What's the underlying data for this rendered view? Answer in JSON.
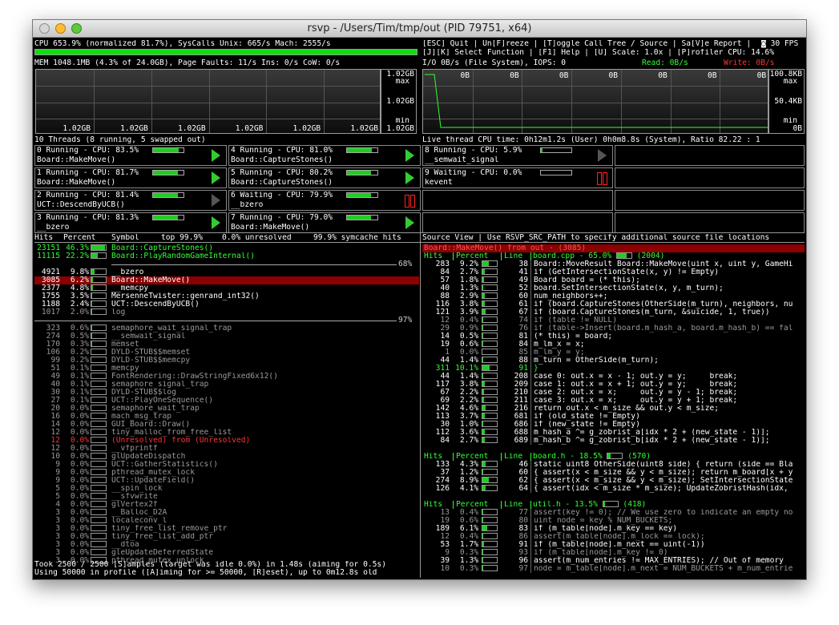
{
  "window": {
    "title": "rsvp - /Users/Tim/tmp/out (PID 79751, x64)"
  },
  "cpu": {
    "text": "CPU 653.9% (normalized 81.7%), SysCalls Unix: 665/s Mach: 2555/s",
    "bar_fraction": 1.0
  },
  "help": {
    "line1": "[ESC] Quit | Un[F]reeze | [T]oggle Call Tree / Source | Sa[V]e Report |",
    "line2": "[J][K] Select Function | [F1] Help | [U] Scale: 1.0x | [P]rofiler CPU: 14.6%",
    "fps": "30 FPS",
    "fps_icon": "camera-icon"
  },
  "mem": {
    "text": "MEM 1048.1MB (4.3% of 24.0GB), Page Faults: 11/s Ins: 0/s CoW: 0/s",
    "graph_labels": [
      "1.02GB",
      "1.02GB",
      "1.02GB",
      "1.02GB",
      "1.02GB",
      "1.02GB"
    ],
    "max_value": "1.02GB",
    "max_label": "max",
    "mid_value": "1.02GB",
    "min_value": "1.02GB",
    "min_label": "min"
  },
  "io": {
    "text": "I/O 0B/s (File System), IOPS: 0",
    "read_label": "Read: 0B/s",
    "write_label": "Write: 0B/s",
    "graph_labels": [
      "0B",
      "0B",
      "0B",
      "0B",
      "0B",
      "0B",
      "0B"
    ],
    "max_value": "100.8KB",
    "max_label": "max",
    "mid_value": "50.4KB",
    "min_label": "min",
    "min_value": "0B"
  },
  "threads": {
    "header": "10 Threads (8 running, 5 swapped out)",
    "live": "Live thread CPU time: 0h12m1.2s (User) 0h0m8.8s (System), Ratio 82.22 : 1",
    "items": [
      {
        "line1": "0 Running - CPU: 83.5%",
        "fn": "Board::MakeMove()",
        "cpu": 0.835,
        "state": "running"
      },
      {
        "line1": "1 Running - CPU: 81.7%",
        "fn": "Board::MakeMove()",
        "cpu": 0.817,
        "state": "running"
      },
      {
        "line1": "2 Running - CPU: 81.4%",
        "fn": "UCT::DescendByUCB()",
        "cpu": 0.814,
        "state": "idle"
      },
      {
        "line1": "3 Running - CPU: 81.3%",
        "fn": "__bzero",
        "cpu": 0.813,
        "state": "running"
      },
      {
        "line1": "4 Running - CPU: 81.0%",
        "fn": "Board::CaptureStones()",
        "cpu": 0.81,
        "state": "running"
      },
      {
        "line1": "5 Running - CPU: 80.2%",
        "fn": "Board::CaptureStones()",
        "cpu": 0.802,
        "state": "running"
      },
      {
        "line1": "6 Waiting - CPU: 79.9%",
        "fn": "__bzero",
        "cpu": 0.799,
        "state": "paused"
      },
      {
        "line1": "7 Running - CPU: 79.0%",
        "fn": "Board::MakeMove()",
        "cpu": 0.79,
        "state": "running"
      },
      {
        "line1": "8 Running - CPU: 5.9%",
        "fn": "__semwait_signal",
        "cpu": 0.059,
        "state": "idle"
      },
      {
        "line1": "9 Waiting - CPU: 0.0%",
        "fn": "kevent",
        "cpu": 0.0,
        "state": "paused"
      }
    ]
  },
  "profile": {
    "header": {
      "hits": "Hits",
      "percent": "Percent",
      "symbol": "Symbol",
      "top": "top 99.9%",
      "unresolved": "0.0% unresolved",
      "symcache": "99.9% symcache hits"
    },
    "marker1": "68%",
    "marker2": "97%",
    "group1": [
      {
        "hits": "23151",
        "pct": "46.3%",
        "frac": 0.463,
        "sym": "Board::CaptureStones()"
      },
      {
        "hits": "11115",
        "pct": "22.2%",
        "frac": 0.222,
        "sym": "Board::PlayRandomGameInternal()"
      }
    ],
    "group2": [
      {
        "hits": "4921",
        "pct": "9.8%",
        "frac": 0.098,
        "sym": "__bzero"
      },
      {
        "hits": "3085",
        "pct": "6.2%",
        "frac": 0.062,
        "sym": "Board::MakeMove()"
      },
      {
        "hits": "2377",
        "pct": "4.8%",
        "frac": 0.048,
        "sym": "__memcpy"
      },
      {
        "hits": "1755",
        "pct": "3.5%",
        "frac": 0.035,
        "sym": "MersenneTwister::genrand_int32()"
      },
      {
        "hits": "1188",
        "pct": "2.4%",
        "frac": 0.024,
        "sym": "UCT::DescendByUCB()"
      },
      {
        "hits": "1017",
        "pct": "2.0%",
        "frac": 0.02,
        "sym": "log"
      }
    ],
    "group3": [
      {
        "hits": "323",
        "pct": "0.6%",
        "frac": 0.006,
        "sym": "semaphore_wait_signal_trap"
      },
      {
        "hits": "274",
        "pct": "0.5%",
        "frac": 0.005,
        "sym": "__semwait_signal"
      },
      {
        "hits": "170",
        "pct": "0.3%",
        "frac": 0.003,
        "sym": "memset"
      },
      {
        "hits": "106",
        "pct": "0.2%",
        "frac": 0.002,
        "sym": "DYLD-STUB$$memset"
      },
      {
        "hits": "99",
        "pct": "0.2%",
        "frac": 0.002,
        "sym": "DYLD-STUB$$memcpy"
      },
      {
        "hits": "51",
        "pct": "0.1%",
        "frac": 0.001,
        "sym": "memcpy"
      },
      {
        "hits": "49",
        "pct": "0.1%",
        "frac": 0.001,
        "sym": "FontRendering::DrawStringFixed6x12()"
      },
      {
        "hits": "40",
        "pct": "0.1%",
        "frac": 0.001,
        "sym": "semaphore_signal_trap"
      },
      {
        "hits": "30",
        "pct": "0.1%",
        "frac": 0.001,
        "sym": "DYLD-STUB$$log"
      },
      {
        "hits": "27",
        "pct": "0.1%",
        "frac": 0.001,
        "sym": "UCT::PlayOneSequence()"
      },
      {
        "hits": "20",
        "pct": "0.0%",
        "frac": 0.0,
        "sym": "semaphore_wait_trap"
      },
      {
        "hits": "16",
        "pct": "0.0%",
        "frac": 0.0,
        "sym": "mach_msg_trap"
      },
      {
        "hits": "14",
        "pct": "0.0%",
        "frac": 0.0,
        "sym": "GUI_Board::Draw()"
      },
      {
        "hits": "12",
        "pct": "0.0%",
        "frac": 0.0,
        "sym": "tiny_malloc_from_free_list"
      },
      {
        "hits": "12",
        "pct": "0.0%",
        "frac": 0.0,
        "sym": "(Unresolved) from (Unresolved)",
        "red": true
      },
      {
        "hits": "12",
        "pct": "0.0%",
        "frac": 0.0,
        "sym": "__vfprintf"
      },
      {
        "hits": "10",
        "pct": "0.0%",
        "frac": 0.0,
        "sym": "glUpdateDispatch"
      },
      {
        "hits": "9",
        "pct": "0.0%",
        "frac": 0.0,
        "sym": "UCT::GatherStatistics()"
      },
      {
        "hits": "9",
        "pct": "0.0%",
        "frac": 0.0,
        "sym": "pthread_mutex_lock"
      },
      {
        "hits": "9",
        "pct": "0.0%",
        "frac": 0.0,
        "sym": "UCT::UpdateField()"
      },
      {
        "hits": "5",
        "pct": "0.0%",
        "frac": 0.0,
        "sym": "__spin_lock"
      },
      {
        "hits": "5",
        "pct": "0.0%",
        "frac": 0.0,
        "sym": "__sfvwrite"
      },
      {
        "hits": "4",
        "pct": "0.0%",
        "frac": 0.0,
        "sym": "glVertex2f"
      },
      {
        "hits": "3",
        "pct": "0.0%",
        "frac": 0.0,
        "sym": "__Balloc_D2A"
      },
      {
        "hits": "3",
        "pct": "0.0%",
        "frac": 0.0,
        "sym": "localeconv_l"
      },
      {
        "hits": "3",
        "pct": "0.0%",
        "frac": 0.0,
        "sym": "tiny_free_list_remove_ptr"
      },
      {
        "hits": "3",
        "pct": "0.0%",
        "frac": 0.0,
        "sym": "tiny_free_list_add_ptr"
      },
      {
        "hits": "3",
        "pct": "0.0%",
        "frac": 0.0,
        "sym": "__dtoa"
      },
      {
        "hits": "3",
        "pct": "0.0%",
        "frac": 0.0,
        "sym": "gleUpdateDeferredState"
      },
      {
        "hits": "3",
        "pct": "0.0%",
        "frac": 0.0,
        "sym": "pthread_mutex_unlock"
      },
      {
        "hits": "3",
        "pct": "0.0%",
        "frac": 0.0,
        "sym": "glRotateXYZ_Exec"
      },
      {
        "hits": "3",
        "pct": "0.0%",
        "frac": 0.0,
        "sym": "UCT::DoWork()"
      }
    ],
    "footer1": "Took 2500 / 2500 [S]amples (target was idle 0.0%) in 1.48s (aiming for 0.5s)",
    "footer2": "Using 50000 in profile ([A]iming for >= 50000, [R]eset), up to 0m12.8s old"
  },
  "source": {
    "header": "Source View | Use RSVP_SRC_PATH to specify additional source file locations",
    "selected": "Board::MakeMove() from out - (3085)",
    "col_hits": "Hits",
    "col_percent": "Percent",
    "col_line": "Line",
    "files": [
      {
        "name": "board.cpp - 65.0%",
        "frac": 0.65,
        "count": "(2004)",
        "lines": [
          {
            "hits": "283",
            "pct": "9.2%",
            "frac": 0.092,
            "line": "38",
            "code": "Board::MoveResult Board::MakeMove(uint x, uint y, GameHi"
          },
          {
            "hits": "84",
            "pct": "2.7%",
            "frac": 0.027,
            "line": "41",
            "code": "if (GetIntersectionState(x, y) != Empty)"
          },
          {
            "hits": "57",
            "pct": "1.8%",
            "frac": 0.018,
            "line": "49",
            "code": "Board board = (* this);"
          },
          {
            "hits": "40",
            "pct": "1.3%",
            "frac": 0.013,
            "line": "52",
            "code": "board.SetIntersectionState(x, y, m_turn);"
          },
          {
            "hits": "88",
            "pct": "2.9%",
            "frac": 0.029,
            "line": "60",
            "code": "num_neighbors++;"
          },
          {
            "hits": "116",
            "pct": "3.8%",
            "frac": 0.038,
            "line": "61",
            "code": "if (board.CaptureStones(OtherSide(m_turn), neighbors, nu"
          },
          {
            "hits": "121",
            "pct": "3.9%",
            "frac": 0.039,
            "line": "67",
            "code": "if (board.CaptureStones(m_turn, &suicide, 1, true))"
          },
          {
            "hits": "12",
            "pct": "0.4%",
            "frac": 0.004,
            "line": "74",
            "code": "if (table != NULL)",
            "dim": true
          },
          {
            "hits": "29",
            "pct": "0.9%",
            "frac": 0.009,
            "line": "76",
            "code": "if (table->Insert(board.m_hash_a, board.m_hash_b) == fal",
            "dim": true
          },
          {
            "hits": "14",
            "pct": "0.5%",
            "frac": 0.005,
            "line": "81",
            "code": "(* this) = board;"
          },
          {
            "hits": "19",
            "pct": "0.6%",
            "frac": 0.006,
            "line": "84",
            "code": "m_lm_x = x;"
          },
          {
            "hits": "1",
            "pct": "0.0%",
            "frac": 0.0,
            "line": "85",
            "code": "m_lm_y = y;",
            "dim": true
          },
          {
            "hits": "44",
            "pct": "1.4%",
            "frac": 0.014,
            "line": "88",
            "code": "m_turn = OtherSide(m_turn);"
          },
          {
            "hits": "311",
            "pct": "10.1%",
            "frac": 0.101,
            "line": "91",
            "code": "}",
            "green": true
          },
          {
            "hits": "44",
            "pct": "1.4%",
            "frac": 0.014,
            "line": "208",
            "code": "case 0: out.x = x - 1; out.y = y;     break;"
          },
          {
            "hits": "117",
            "pct": "3.8%",
            "frac": 0.038,
            "line": "209",
            "code": "case 1: out.x = x + 1; out.y = y;     break;"
          },
          {
            "hits": "67",
            "pct": "2.2%",
            "frac": 0.022,
            "line": "210",
            "code": "case 2: out.x = x;     out.y = y - 1; break;"
          },
          {
            "hits": "69",
            "pct": "2.2%",
            "frac": 0.022,
            "line": "211",
            "code": "case 3: out.x = x;     out.y = y + 1; break;"
          },
          {
            "hits": "142",
            "pct": "4.6%",
            "frac": 0.046,
            "line": "216",
            "code": "return out.x < m_size && out.y < m_size;"
          },
          {
            "hits": "113",
            "pct": "3.7%",
            "frac": 0.037,
            "line": "681",
            "code": "if (old_state != Empty)"
          },
          {
            "hits": "30",
            "pct": "1.0%",
            "frac": 0.01,
            "line": "686",
            "code": "if (new_state != Empty)"
          },
          {
            "hits": "112",
            "pct": "3.6%",
            "frac": 0.036,
            "line": "688",
            "code": "m_hash_a ^= g_zobrist_a[idx * 2 + (new_state - 1)];"
          },
          {
            "hits": "84",
            "pct": "2.7%",
            "frac": 0.027,
            "line": "689",
            "code": "m_hash_b ^= g_zobrist_b[idx * 2 + (new_state - 1)];"
          }
        ]
      },
      {
        "name": "board.h - 18.5%",
        "frac": 0.185,
        "count": "(570)",
        "lines": [
          {
            "hits": "133",
            "pct": "4.3%",
            "frac": 0.043,
            "line": "46",
            "code": "static uint8 OtherSide(uint8 side) { return (side == Bla"
          },
          {
            "hits": "37",
            "pct": "1.2%",
            "frac": 0.012,
            "line": "60",
            "code": "{ assert(x < m_size && y < m_size); return m_board[x + y"
          },
          {
            "hits": "274",
            "pct": "8.9%",
            "frac": 0.089,
            "line": "62",
            "code": "{ assert(x < m_size && y < m_size); SetIntersectionState"
          },
          {
            "hits": "126",
            "pct": "4.1%",
            "frac": 0.041,
            "line": "64",
            "code": "{ assert(idx < m_size * m_size); UpdateZobristHash(idx,"
          }
        ]
      },
      {
        "name": "util.h - 13.5%",
        "frac": 0.135,
        "count": "(418)",
        "lines": [
          {
            "hits": "13",
            "pct": "0.4%",
            "frac": 0.004,
            "line": "77",
            "code": "assert(key != 0); // We use zero to indicate an empty no",
            "dim": true
          },
          {
            "hits": "19",
            "pct": "0.6%",
            "frac": 0.006,
            "line": "80",
            "code": "uint node = key % NUM_BUCKETS;",
            "dim": true
          },
          {
            "hits": "189",
            "pct": "6.1%",
            "frac": 0.061,
            "line": "83",
            "code": "if (m_table[node].m_key == key)"
          },
          {
            "hits": "12",
            "pct": "0.4%",
            "frac": 0.004,
            "line": "86",
            "code": "assert(m_table[node].m_lock == lock);",
            "dim": true
          },
          {
            "hits": "53",
            "pct": "1.7%",
            "frac": 0.017,
            "line": "91",
            "code": "if (m_table[node].m_next == uint(-1))"
          },
          {
            "hits": "9",
            "pct": "0.3%",
            "frac": 0.003,
            "line": "93",
            "code": "if (m_table[node].m_key != 0)",
            "dim": true
          },
          {
            "hits": "39",
            "pct": "1.3%",
            "frac": 0.013,
            "line": "96",
            "code": "assert(m_num_entries != MAX_ENTRIES); // Out of memory"
          },
          {
            "hits": "10",
            "pct": "0.3%",
            "frac": 0.003,
            "line": "97",
            "code": "node = m_table[node].m_next = NUM_BUCKETS + m_num_entrie",
            "dim": true
          },
          {
            "hits": "21",
            "pct": "0.7%",
            "frac": 0.007,
            "line": "99",
            "code": "m_num_entries++;",
            "dim": true
          },
          {
            "hits": "33",
            "pct": "1.1%",
            "frac": 0.011,
            "line": "103",
            "code": "new_node->m_key = key;"
          },
          {
            "hits": "26",
            "pct": "0.8%",
            "frac": 0.008,
            "line": "104",
            "code": "new_node->m_lock = lock;",
            "dim": true
          }
        ]
      }
    ]
  }
}
